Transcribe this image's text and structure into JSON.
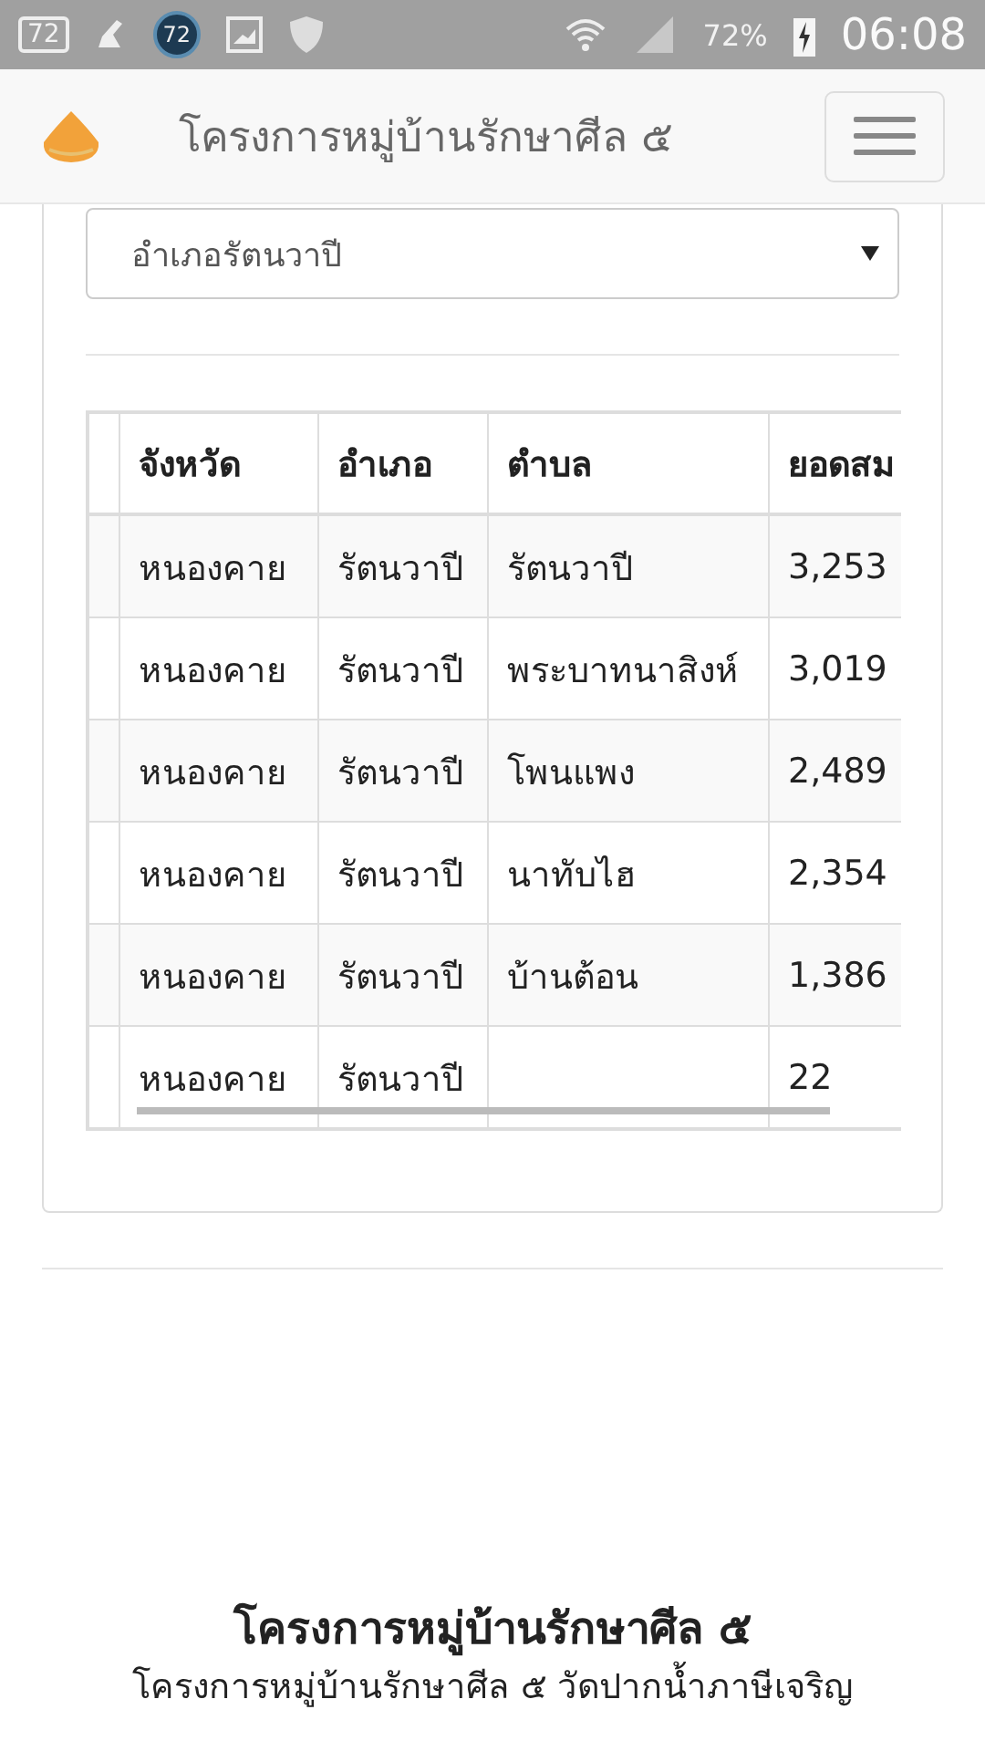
{
  "status_bar": {
    "battery_badge": "72",
    "circle_badge": "72",
    "battery_percent": "72%",
    "time": "06:08"
  },
  "navbar": {
    "title": "โครงการหมู่บ้านรักษาศีล ๕"
  },
  "filter": {
    "value": "อำเภอรัตนวาปี"
  },
  "table": {
    "columns": [
      "",
      "จังหวัด",
      "อำเภอ",
      "ตำบล",
      "ยอดสม"
    ],
    "rows": [
      [
        "",
        "หนองคาย",
        "รัตนวาปี",
        "รัตนวาปี",
        "3,253"
      ],
      [
        "",
        "หนองคาย",
        "รัตนวาปี",
        "พระบาทนาสิงห์",
        "3,019"
      ],
      [
        "",
        "หนองคาย",
        "รัตนวาปี",
        "โพนแพง",
        "2,489"
      ],
      [
        "",
        "หนองคาย",
        "รัตนวาปี",
        "นาทับไฮ",
        "2,354"
      ],
      [
        "",
        "หนองคาย",
        "รัตนวาปี",
        "บ้านต้อน",
        "1,386"
      ],
      [
        "",
        "หนองคาย",
        "รัตนวาปี",
        "",
        "22"
      ]
    ]
  },
  "footer": {
    "title": "โครงการหมู่บ้านรักษาศีล ๕",
    "subtitle": "โครงการหมู่บ้านรักษาศีล ๕ วัดปากน้ำภาษีเจริญ"
  }
}
